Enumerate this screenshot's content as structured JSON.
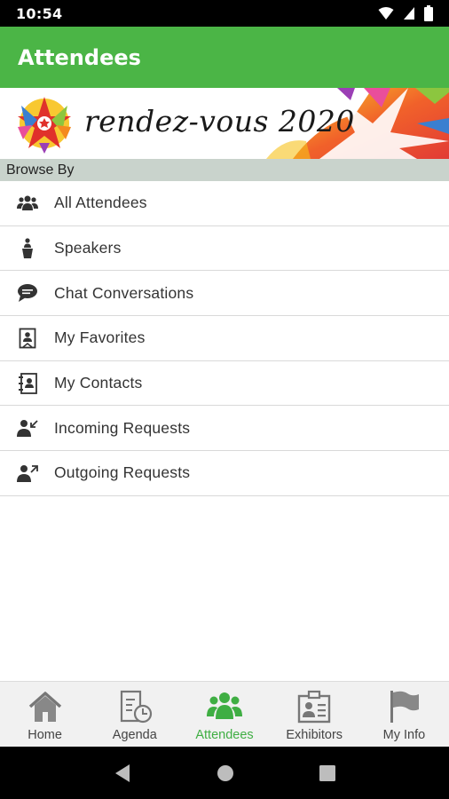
{
  "status_bar": {
    "time": "10:54"
  },
  "app_bar": {
    "title": "Attendees"
  },
  "banner": {
    "text": "rendez-vous 2020"
  },
  "section": {
    "header": "Browse By"
  },
  "menu": {
    "items": [
      {
        "label": "All Attendees",
        "icon": "people-icon"
      },
      {
        "label": "Speakers",
        "icon": "speaker-podium-icon"
      },
      {
        "label": "Chat Conversations",
        "icon": "chat-bubble-icon"
      },
      {
        "label": "My Favorites",
        "icon": "favorite-bookmark-icon"
      },
      {
        "label": "My Contacts",
        "icon": "contacts-book-icon"
      },
      {
        "label": "Incoming Requests",
        "icon": "incoming-request-icon"
      },
      {
        "label": "Outgoing Requests",
        "icon": "outgoing-request-icon"
      }
    ]
  },
  "bottom_nav": {
    "items": [
      {
        "label": "Home",
        "icon": "home-icon",
        "active": false
      },
      {
        "label": "Agenda",
        "icon": "agenda-icon",
        "active": false
      },
      {
        "label": "Attendees",
        "icon": "attendees-icon",
        "active": true
      },
      {
        "label": "Exhibitors",
        "icon": "exhibitors-icon",
        "active": false
      },
      {
        "label": "My Info",
        "icon": "flag-icon",
        "active": false
      }
    ]
  },
  "colors": {
    "primary": "#4bb546",
    "active_nav": "#3fae43",
    "section_header_bg": "#c9d3cc"
  }
}
